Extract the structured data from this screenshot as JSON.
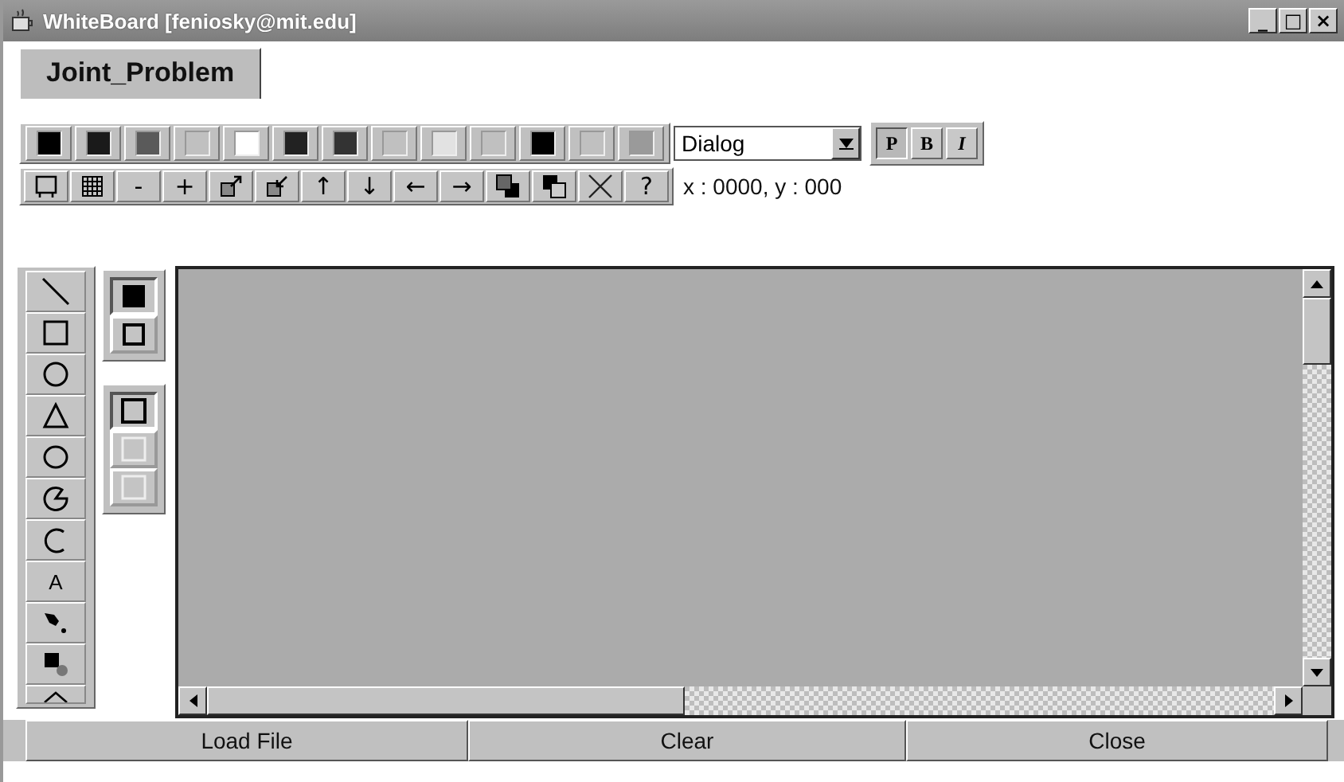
{
  "window": {
    "title": "WhiteBoard [feniosky@mit.edu]",
    "controls": [
      "_",
      "□",
      "×"
    ]
  },
  "tabs": [
    {
      "label": "Joint_Problem",
      "selected": true
    }
  ],
  "palette": [
    {
      "color": "#000000"
    },
    {
      "color": "#1a1a1a"
    },
    {
      "color": "#5a5a5a"
    },
    {
      "color": "#c0c0c0"
    },
    {
      "color": "#ffffff"
    },
    {
      "color": "#222222"
    },
    {
      "color": "#333333"
    },
    {
      "color": "#c0c0c0"
    },
    {
      "color": "#e2e2e2"
    },
    {
      "color": "#c0c0c0"
    },
    {
      "color": "#000000"
    },
    {
      "color": "#c0c0c0"
    },
    {
      "color": "#9a9a9a"
    }
  ],
  "font": {
    "value": "Dialog"
  },
  "font_styles": [
    {
      "label": "P",
      "selected": true
    },
    {
      "label": "B",
      "selected": false
    },
    {
      "label": "I",
      "selected": false
    }
  ],
  "toolbar": [
    {
      "kind": "icon"
    },
    {
      "kind": "icon"
    },
    {
      "kind": "text",
      "text": "-"
    },
    {
      "kind": "text",
      "text": "+"
    },
    {
      "kind": "icon"
    },
    {
      "kind": "icon"
    },
    {
      "kind": "text",
      "text": "↑"
    },
    {
      "kind": "text",
      "text": "↓"
    },
    {
      "kind": "text",
      "text": "←"
    },
    {
      "kind": "text",
      "text": "→"
    },
    {
      "kind": "icon"
    },
    {
      "kind": "icon"
    },
    {
      "kind": "icon"
    },
    {
      "kind": "text",
      "text": "?"
    }
  ],
  "coordinates": "x : 0000, y : 000",
  "shape_tools": [
    {
      "kind": "icon"
    },
    {
      "kind": "icon"
    },
    {
      "kind": "icon"
    },
    {
      "kind": "icon"
    },
    {
      "kind": "icon"
    },
    {
      "kind": "icon"
    },
    {
      "kind": "icon"
    },
    {
      "kind": "text",
      "text": "A"
    },
    {
      "kind": "icon"
    },
    {
      "kind": "icon"
    },
    {
      "kind": "icon"
    }
  ],
  "fill_modes": [
    {
      "selected": true
    },
    {
      "selected": false
    }
  ],
  "line_styles": [
    {
      "selected": true
    },
    {
      "selected": false
    },
    {
      "selected": false
    }
  ],
  "buttons": [
    "Load File",
    "Clear",
    "Close"
  ]
}
